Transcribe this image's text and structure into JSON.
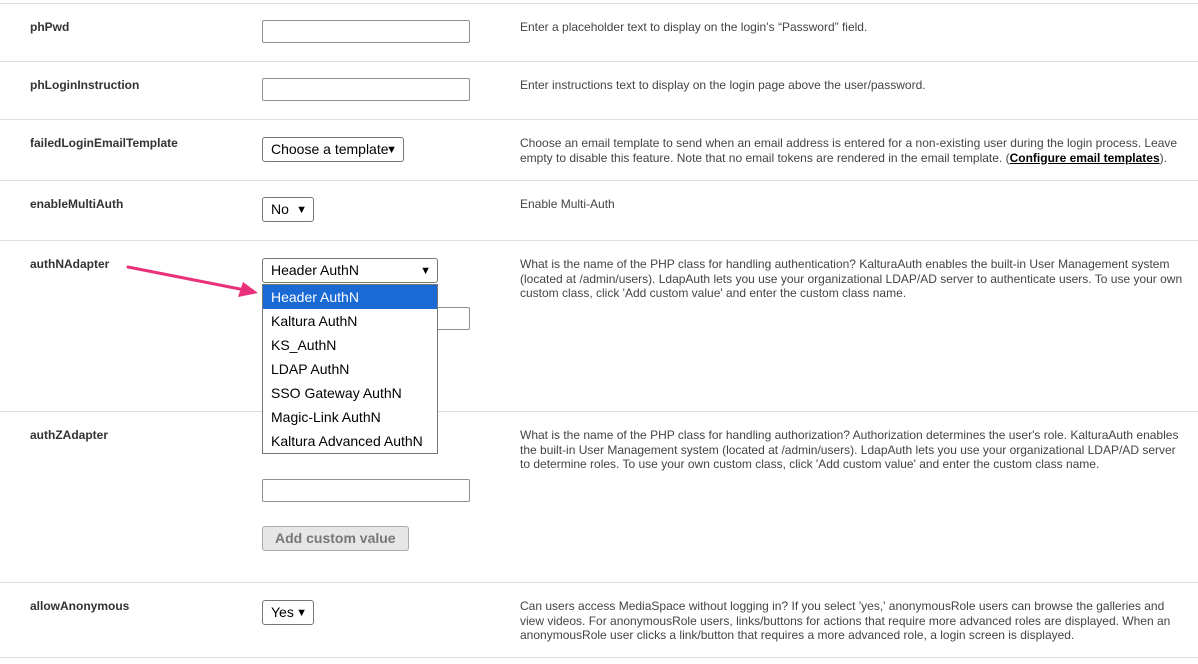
{
  "rows": {
    "phPwd": {
      "label": "phPwd",
      "description": "Enter a placeholder text to display on the login’s “Password” field."
    },
    "phLoginInstruction": {
      "label": "phLoginInstruction",
      "description": "Enter instructions text to display on the login page above the user/password."
    },
    "failedLoginEmailTemplate": {
      "label": "failedLoginEmailTemplate",
      "select_value": "Choose a template",
      "description": "Choose an email template to send when an email address is entered for a non-existing user during the login process. Leave empty to disable this feature. Note that no email tokens are rendered in the email template. (",
      "link": "Configure email templates",
      "description_end": ")."
    },
    "enableMultiAuth": {
      "label": "enableMultiAuth",
      "select_value": "No",
      "description": "Enable Multi-Auth"
    },
    "authNAdapter": {
      "label": "authNAdapter",
      "select_value": "Header AuthN",
      "description": "What is the name of the PHP class for handling authentication? KalturaAuth enables the built-in User Management system (located at /admin/users). LdapAuth lets you use your organizational LDAP/AD server to authenticate users. To use your own custom class, click 'Add custom value' and enter the custom class name.",
      "options": [
        "Header AuthN",
        "Kaltura AuthN",
        "KS_AuthN",
        "LDAP AuthN",
        "SSO Gateway AuthN",
        "Magic-Link AuthN",
        "Kaltura Advanced AuthN"
      ]
    },
    "authZAdapter": {
      "label": "authZAdapter",
      "description": "What is the name of the PHP class for handling authorization? Authorization determines the user's role. KalturaAuth enables the built-in User Management system (located at /admin/users). LdapAuth lets you use your organizational LDAP/AD server to determine roles. To use your own custom class, click 'Add custom value' and enter the custom class name.",
      "add_button": "Add custom value"
    },
    "allowAnonymous": {
      "label": "allowAnonymous",
      "select_value": "Yes",
      "description": "Can users access MediaSpace without logging in? If you select 'yes,' anonymousRole users can browse the galleries and view videos. For anonymousRole users, links/buttons for actions that require more advanced roles are displayed. When an anonymousRole user clicks a link/button that requires a more advanced role, a login screen is displayed."
    }
  },
  "colors": {
    "highlight": "#1a6ad6",
    "arrow": "#e8317a"
  },
  "icons": {
    "select_chevron": "chevron-down-icon"
  }
}
